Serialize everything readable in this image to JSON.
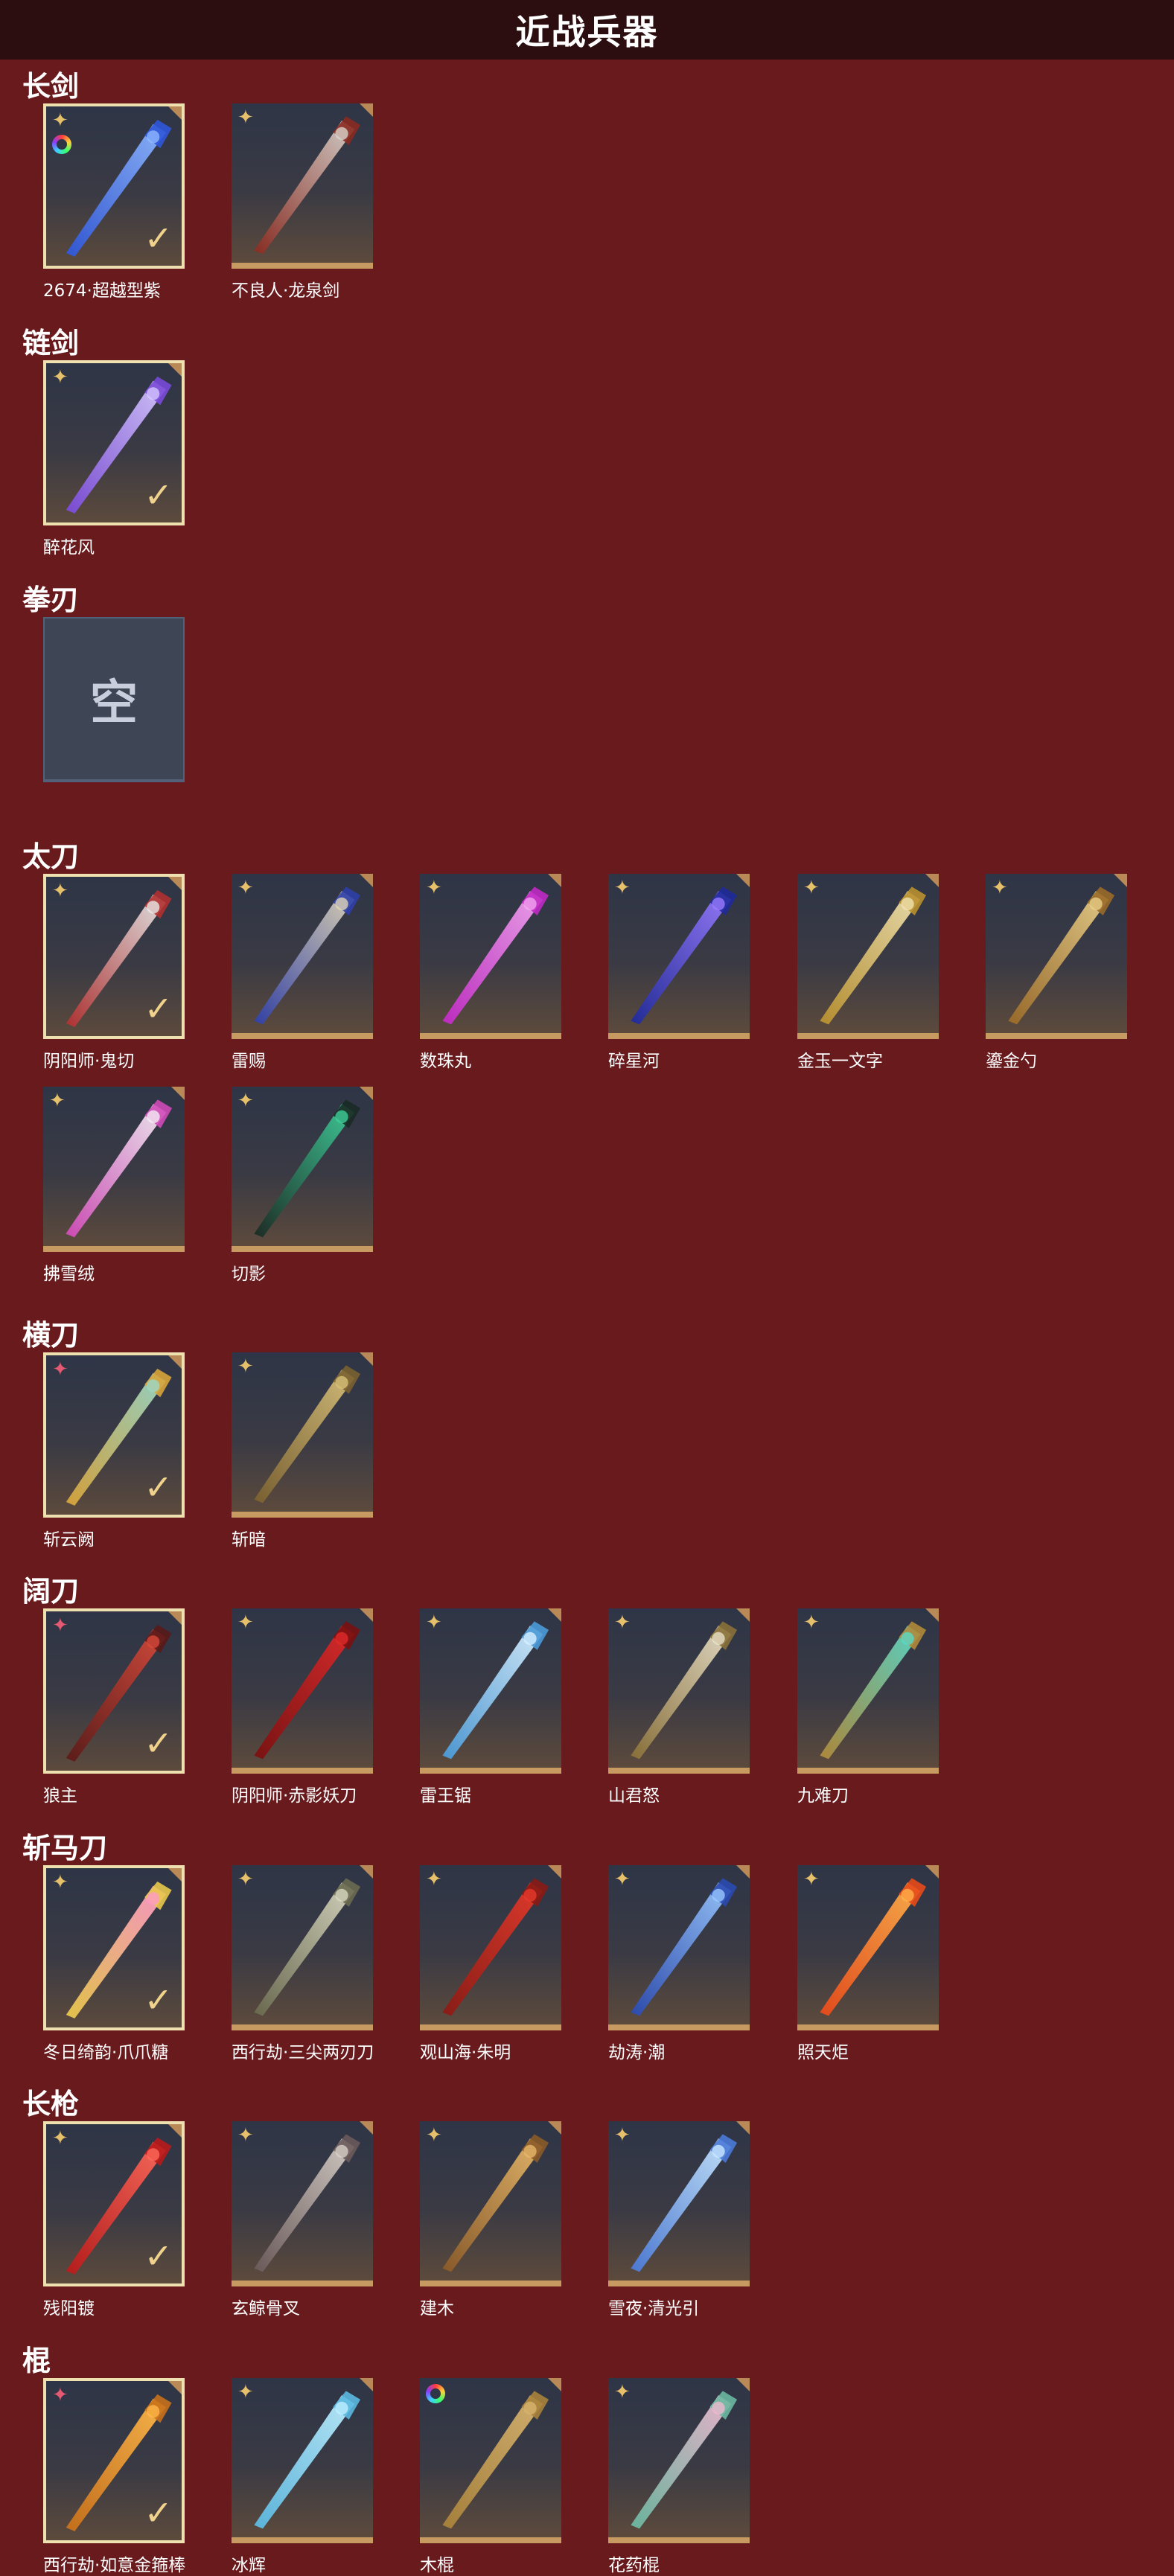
{
  "page_title": "近战兵器",
  "empty_label": "空",
  "check_mark": "✓",
  "star_glyph": "✦",
  "categories": [
    {
      "name": "长剑",
      "items": [
        {
          "label": "2674·超越型紫",
          "equipped": true,
          "rainbow": true,
          "star": "gold",
          "colors": [
            "#8fb8ff",
            "#2f56d8"
          ]
        },
        {
          "label": "不良人·龙泉剑",
          "equipped": false,
          "star": "gold",
          "colors": [
            "#d8d3cc",
            "#8a2a20"
          ]
        }
      ]
    },
    {
      "name": "链剑",
      "items": [
        {
          "label": "醉花风",
          "equipped": true,
          "star": "gold",
          "colors": [
            "#d6c8ff",
            "#7a4ad8"
          ]
        }
      ]
    },
    {
      "name": "拳刃",
      "items": [
        {
          "label": "",
          "empty": true
        }
      ]
    },
    {
      "name": "太刀",
      "items": [
        {
          "label": "阴阳师·鬼切",
          "equipped": true,
          "star": "gold",
          "colors": [
            "#e8e8e8",
            "#b03030"
          ]
        },
        {
          "label": "雷赐",
          "equipped": false,
          "star": "gold",
          "colors": [
            "#e0d6b8",
            "#2f3fa8"
          ]
        },
        {
          "label": "数珠丸",
          "equipped": false,
          "star": "gold",
          "colors": [
            "#f2a6f0",
            "#c02ac4"
          ]
        },
        {
          "label": "碎星河",
          "equipped": false,
          "star": "gold",
          "colors": [
            "#9a7cff",
            "#1f2a9a"
          ]
        },
        {
          "label": "金玉一文字",
          "equipped": false,
          "star": "gold",
          "colors": [
            "#f0e2b0",
            "#b8902e"
          ]
        },
        {
          "label": "鎏金勺",
          "equipped": false,
          "star": "gold",
          "colors": [
            "#e8cf8a",
            "#9a6a28"
          ]
        },
        {
          "label": "拂雪绒",
          "equipped": false,
          "star": "gold",
          "colors": [
            "#f4eef4",
            "#d04ab8"
          ]
        },
        {
          "label": "切影",
          "equipped": false,
          "star": "gold",
          "colors": [
            "#3fcf9a",
            "#1a2a24"
          ]
        }
      ]
    },
    {
      "name": "横刀",
      "items": [
        {
          "label": "斩云阙",
          "equipped": true,
          "star": "red",
          "colors": [
            "#9ad8c8",
            "#d8a43a"
          ]
        },
        {
          "label": "斩暗",
          "equipped": false,
          "star": "gold",
          "colors": [
            "#d8c07a",
            "#7a6030"
          ]
        }
      ]
    },
    {
      "name": "阔刀",
      "items": [
        {
          "label": "狼主",
          "equipped": true,
          "star": "red",
          "colors": [
            "#d84a3a",
            "#5a1a18"
          ]
        },
        {
          "label": "阴阳师·赤影妖刀",
          "equipped": false,
          "star": "gold",
          "colors": [
            "#e02a2a",
            "#7a1010"
          ]
        },
        {
          "label": "雷王锯",
          "equipped": false,
          "star": "gold",
          "colors": [
            "#d8f0ff",
            "#4a9ad8"
          ]
        },
        {
          "label": "山君怒",
          "equipped": false,
          "star": "gold",
          "colors": [
            "#e8e0c8",
            "#8a7038"
          ]
        },
        {
          "label": "九难刀",
          "equipped": false,
          "star": "gold",
          "colors": [
            "#5ad8c8",
            "#b08a3a"
          ]
        }
      ]
    },
    {
      "name": "斩马刀",
      "items": [
        {
          "label": "冬日绮韵·爪爪糖",
          "equipped": true,
          "star": "gold",
          "colors": [
            "#ff9ac8",
            "#e8c84a"
          ]
        },
        {
          "label": "西行劫·三尖两刃刀",
          "equipped": false,
          "star": "gold",
          "colors": [
            "#d8d8c0",
            "#6a6a50"
          ]
        },
        {
          "label": "观山海·朱明",
          "equipped": false,
          "star": "gold",
          "colors": [
            "#e83a2a",
            "#8a1a14"
          ]
        },
        {
          "label": "劫涛·潮",
          "equipped": false,
          "star": "gold",
          "colors": [
            "#9ac8ff",
            "#2a4ab0"
          ]
        },
        {
          "label": "照天炬",
          "equipped": false,
          "star": "gold",
          "colors": [
            "#ffb04a",
            "#e84a1a"
          ]
        }
      ]
    },
    {
      "name": "长枪",
      "items": [
        {
          "label": "残阳镀",
          "equipped": true,
          "star": "gold",
          "colors": [
            "#ff6a5a",
            "#b81a1a"
          ]
        },
        {
          "label": "玄鲸骨叉",
          "equipped": false,
          "star": "gold",
          "colors": [
            "#d8d0c8",
            "#6a5a5a"
          ]
        },
        {
          "label": "建木",
          "equipped": false,
          "star": "gold",
          "colors": [
            "#e8b86a",
            "#8a5a28"
          ]
        },
        {
          "label": "雪夜·清光引",
          "equipped": false,
          "star": "gold",
          "colors": [
            "#c8e8ff",
            "#4a7ad8"
          ]
        }
      ]
    },
    {
      "name": "棍",
      "items": [
        {
          "label": "西行劫·如意金箍棒",
          "equipped": true,
          "star": "red",
          "colors": [
            "#ffb84a",
            "#c8701a"
          ]
        },
        {
          "label": "冰辉",
          "equipped": false,
          "star": "gold",
          "colors": [
            "#bfefff",
            "#5ab8e0"
          ]
        },
        {
          "label": "木棍",
          "equipped": false,
          "rainbow": true,
          "star": "none",
          "colors": [
            "#d8b470",
            "#a8823a"
          ]
        },
        {
          "label": "花药棍",
          "equipped": false,
          "star": "gold",
          "colors": [
            "#f0b8d0",
            "#6ab8a0"
          ]
        }
      ]
    }
  ]
}
